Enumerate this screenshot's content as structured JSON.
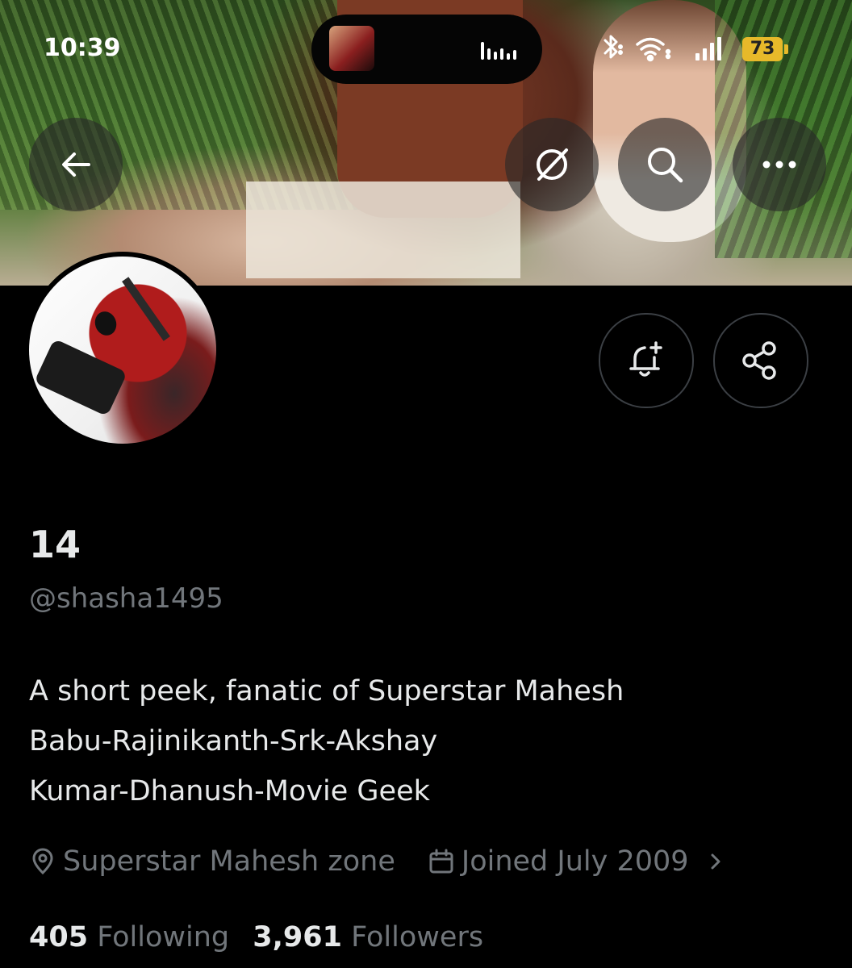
{
  "status_bar": {
    "time": "10:39",
    "battery": "73",
    "icons": [
      "bluetooth-icon",
      "wifi-icon",
      "signal-icon",
      "battery-icon"
    ]
  },
  "island": {
    "activity": "media-playing",
    "icons": [
      "album-art-icon",
      "audio-waveform-icon"
    ]
  },
  "top_nav": {
    "icons": [
      "back-arrow-icon",
      "grok-icon",
      "search-icon",
      "more-icon"
    ]
  },
  "profile_actions": {
    "icons": [
      "notification-bell-plus-icon",
      "share-icon"
    ]
  },
  "profile": {
    "name": "14",
    "handle": "@shasha1495",
    "bio_lines": [
      "A short peek, fanatic of Superstar Mahesh",
      "Babu-Rajinikanth-Srk-Akshay",
      "Kumar-Dhanush-Movie Geek"
    ],
    "location": "Superstar Mahesh zone",
    "joined": "Joined July 2009",
    "following_count": "405",
    "following_label": "Following",
    "followers_count": "3,961",
    "followers_label": "Followers"
  },
  "colors": {
    "background": "#000000",
    "primary_text": "#e7e9ea",
    "secondary_text": "#71767b",
    "battery": "#e7b92a"
  }
}
